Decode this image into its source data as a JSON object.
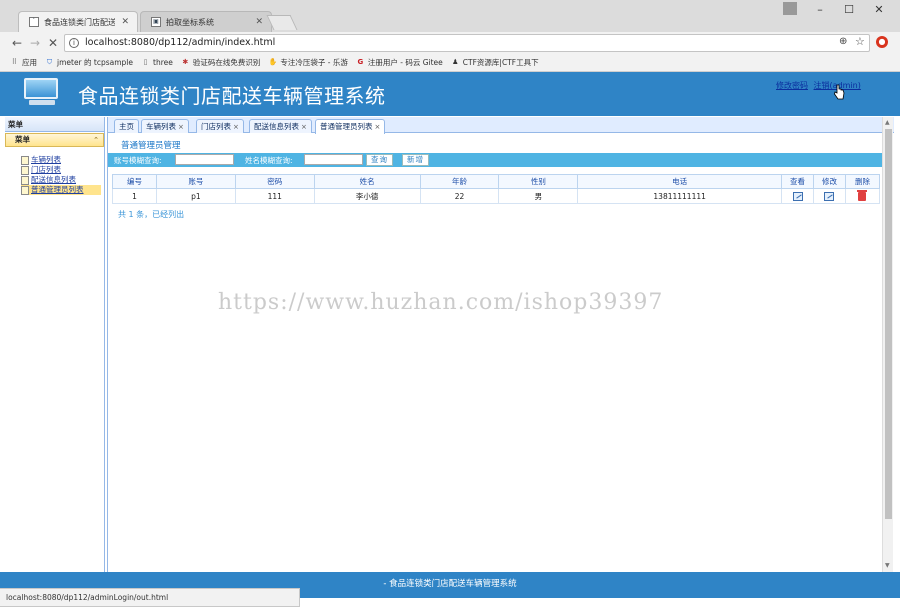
{
  "browser": {
    "tabs": [
      {
        "title": "食品连锁类门店配送车辆",
        "active": true
      },
      {
        "title": "拍取坐标系统",
        "active": false
      }
    ],
    "url": "localhost:8080/dp112/admin/index.html",
    "bookmarks": [
      {
        "label": "应用",
        "icon": "apps-icon"
      },
      {
        "label": "jmeter 的 tcpsample",
        "icon": "shield-icon"
      },
      {
        "label": "three",
        "icon": "page-icon"
      },
      {
        "label": "验证码在线免费识别",
        "icon": "bug-icon"
      },
      {
        "label": "专注冷压袋子 - 乐游",
        "icon": "hand-icon"
      },
      {
        "label": "注册用户 - 码云 Gitee",
        "icon": "gitee-icon"
      },
      {
        "label": "CTF资源库|CTF工具下",
        "icon": "person-icon"
      }
    ],
    "status_url": "localhost:8080/dp112/adminLogin/out.html"
  },
  "header": {
    "title": "食品连锁类门店配送车辆管理系统",
    "links": [
      {
        "label": "修改密码"
      },
      {
        "label": "注销(admin)"
      }
    ]
  },
  "sidebar": {
    "title": "菜单",
    "group": "菜单",
    "items": [
      {
        "label": "车辆列表",
        "selected": false
      },
      {
        "label": "门店列表",
        "selected": false
      },
      {
        "label": "配送信息列表",
        "selected": false
      },
      {
        "label": "普通管理员列表",
        "selected": true
      }
    ]
  },
  "page_tabs": [
    {
      "label": "主页",
      "closable": false
    },
    {
      "label": "车辆列表",
      "closable": true
    },
    {
      "label": "门店列表",
      "closable": true
    },
    {
      "label": "配送信息列表",
      "closable": true
    },
    {
      "label": "普通管理员列表",
      "closable": true,
      "active": true
    }
  ],
  "content": {
    "panel_title": "普通管理员管理",
    "search": {
      "account_label": "账号模糊查询:",
      "name_label": "姓名模糊查询:",
      "query_button": "查询",
      "add_button": "新增"
    },
    "table": {
      "columns": [
        "编号",
        "账号",
        "密码",
        "姓名",
        "年龄",
        "性别",
        "电话",
        "查看",
        "修改",
        "删除"
      ],
      "rows": [
        {
          "id": "1",
          "account": "p1",
          "password": "111",
          "name": "李小德",
          "age": "22",
          "gender": "男",
          "phone": "13811111111"
        }
      ]
    },
    "summary": "共 1 条，已经列出"
  },
  "watermark": "https://www.huzhan.com/ishop39397",
  "footer": "- 食品连锁类门店配送车辆管理系统",
  "colors": {
    "header_blue": "#2f84c6",
    "search_bar": "#4fb4e3",
    "accordion_yellow": "#ffe48d",
    "delete_red": "#e04040"
  }
}
